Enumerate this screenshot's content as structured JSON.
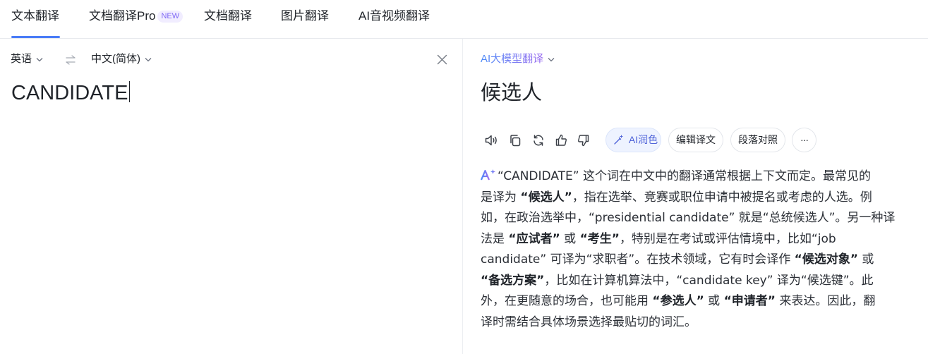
{
  "tabs": [
    {
      "label": "文本翻译",
      "active": true
    },
    {
      "label": "文档翻译Pro",
      "badge": "NEW"
    },
    {
      "label": "文档翻译"
    },
    {
      "label": "图片翻译"
    },
    {
      "label": "AI音视频翻译"
    }
  ],
  "source": {
    "language": "英语",
    "target_language": "中文(简体)",
    "text": "CANDIDATE"
  },
  "target": {
    "engine": "AI大模型翻译",
    "translation": "候选人",
    "actions": {
      "ai_polish": "AI润色",
      "edit": "编辑译文",
      "parallel": "段落对照",
      "more": "···"
    },
    "explanation": [
      [
        {
          "t": "“CANDIDATE” 这个词在中文中的翻译通常根据上下文而定。最常见的"
        }
      ],
      [
        {
          "t": "是译为 "
        },
        {
          "t": "“候选人”",
          "b": true
        },
        {
          "t": "，指在选举、竞赛或职位申请中被提名或考虑的人选。例"
        }
      ],
      [
        {
          "t": "如，在政治选举中，“presidential candidate” 就是“总统候选人”。另一种译"
        }
      ],
      [
        {
          "t": "法是 "
        },
        {
          "t": "“应试者”",
          "b": true
        },
        {
          "t": " 或 "
        },
        {
          "t": "“考生”",
          "b": true
        },
        {
          "t": "，特别是在考试或评估情境中，比如“job"
        }
      ],
      [
        {
          "t": "candidate” 可译为“求职者”。在技术领域，它有时会译作 "
        },
        {
          "t": "“候选对象”",
          "b": true
        },
        {
          "t": " 或"
        }
      ],
      [
        {
          "t": "“备选方案”",
          "b": true
        },
        {
          "t": "，比如在计算机算法中，“candidate key” 译为“候选键”。此"
        }
      ],
      [
        {
          "t": "外，在更随意的场合，也可能用 "
        },
        {
          "t": "“参选人”",
          "b": true
        },
        {
          "t": " 或 "
        },
        {
          "t": "“申请者”",
          "b": true
        },
        {
          "t": " 来表达。因此，翻"
        }
      ],
      [
        {
          "t": "译时需结合具体场景选择最贴切的词汇。"
        }
      ]
    ]
  },
  "colors": {
    "accent": "#4a7cf7",
    "ai_gradient_start": "#4d8bf7",
    "ai_gradient_end": "#9b6cf0"
  }
}
